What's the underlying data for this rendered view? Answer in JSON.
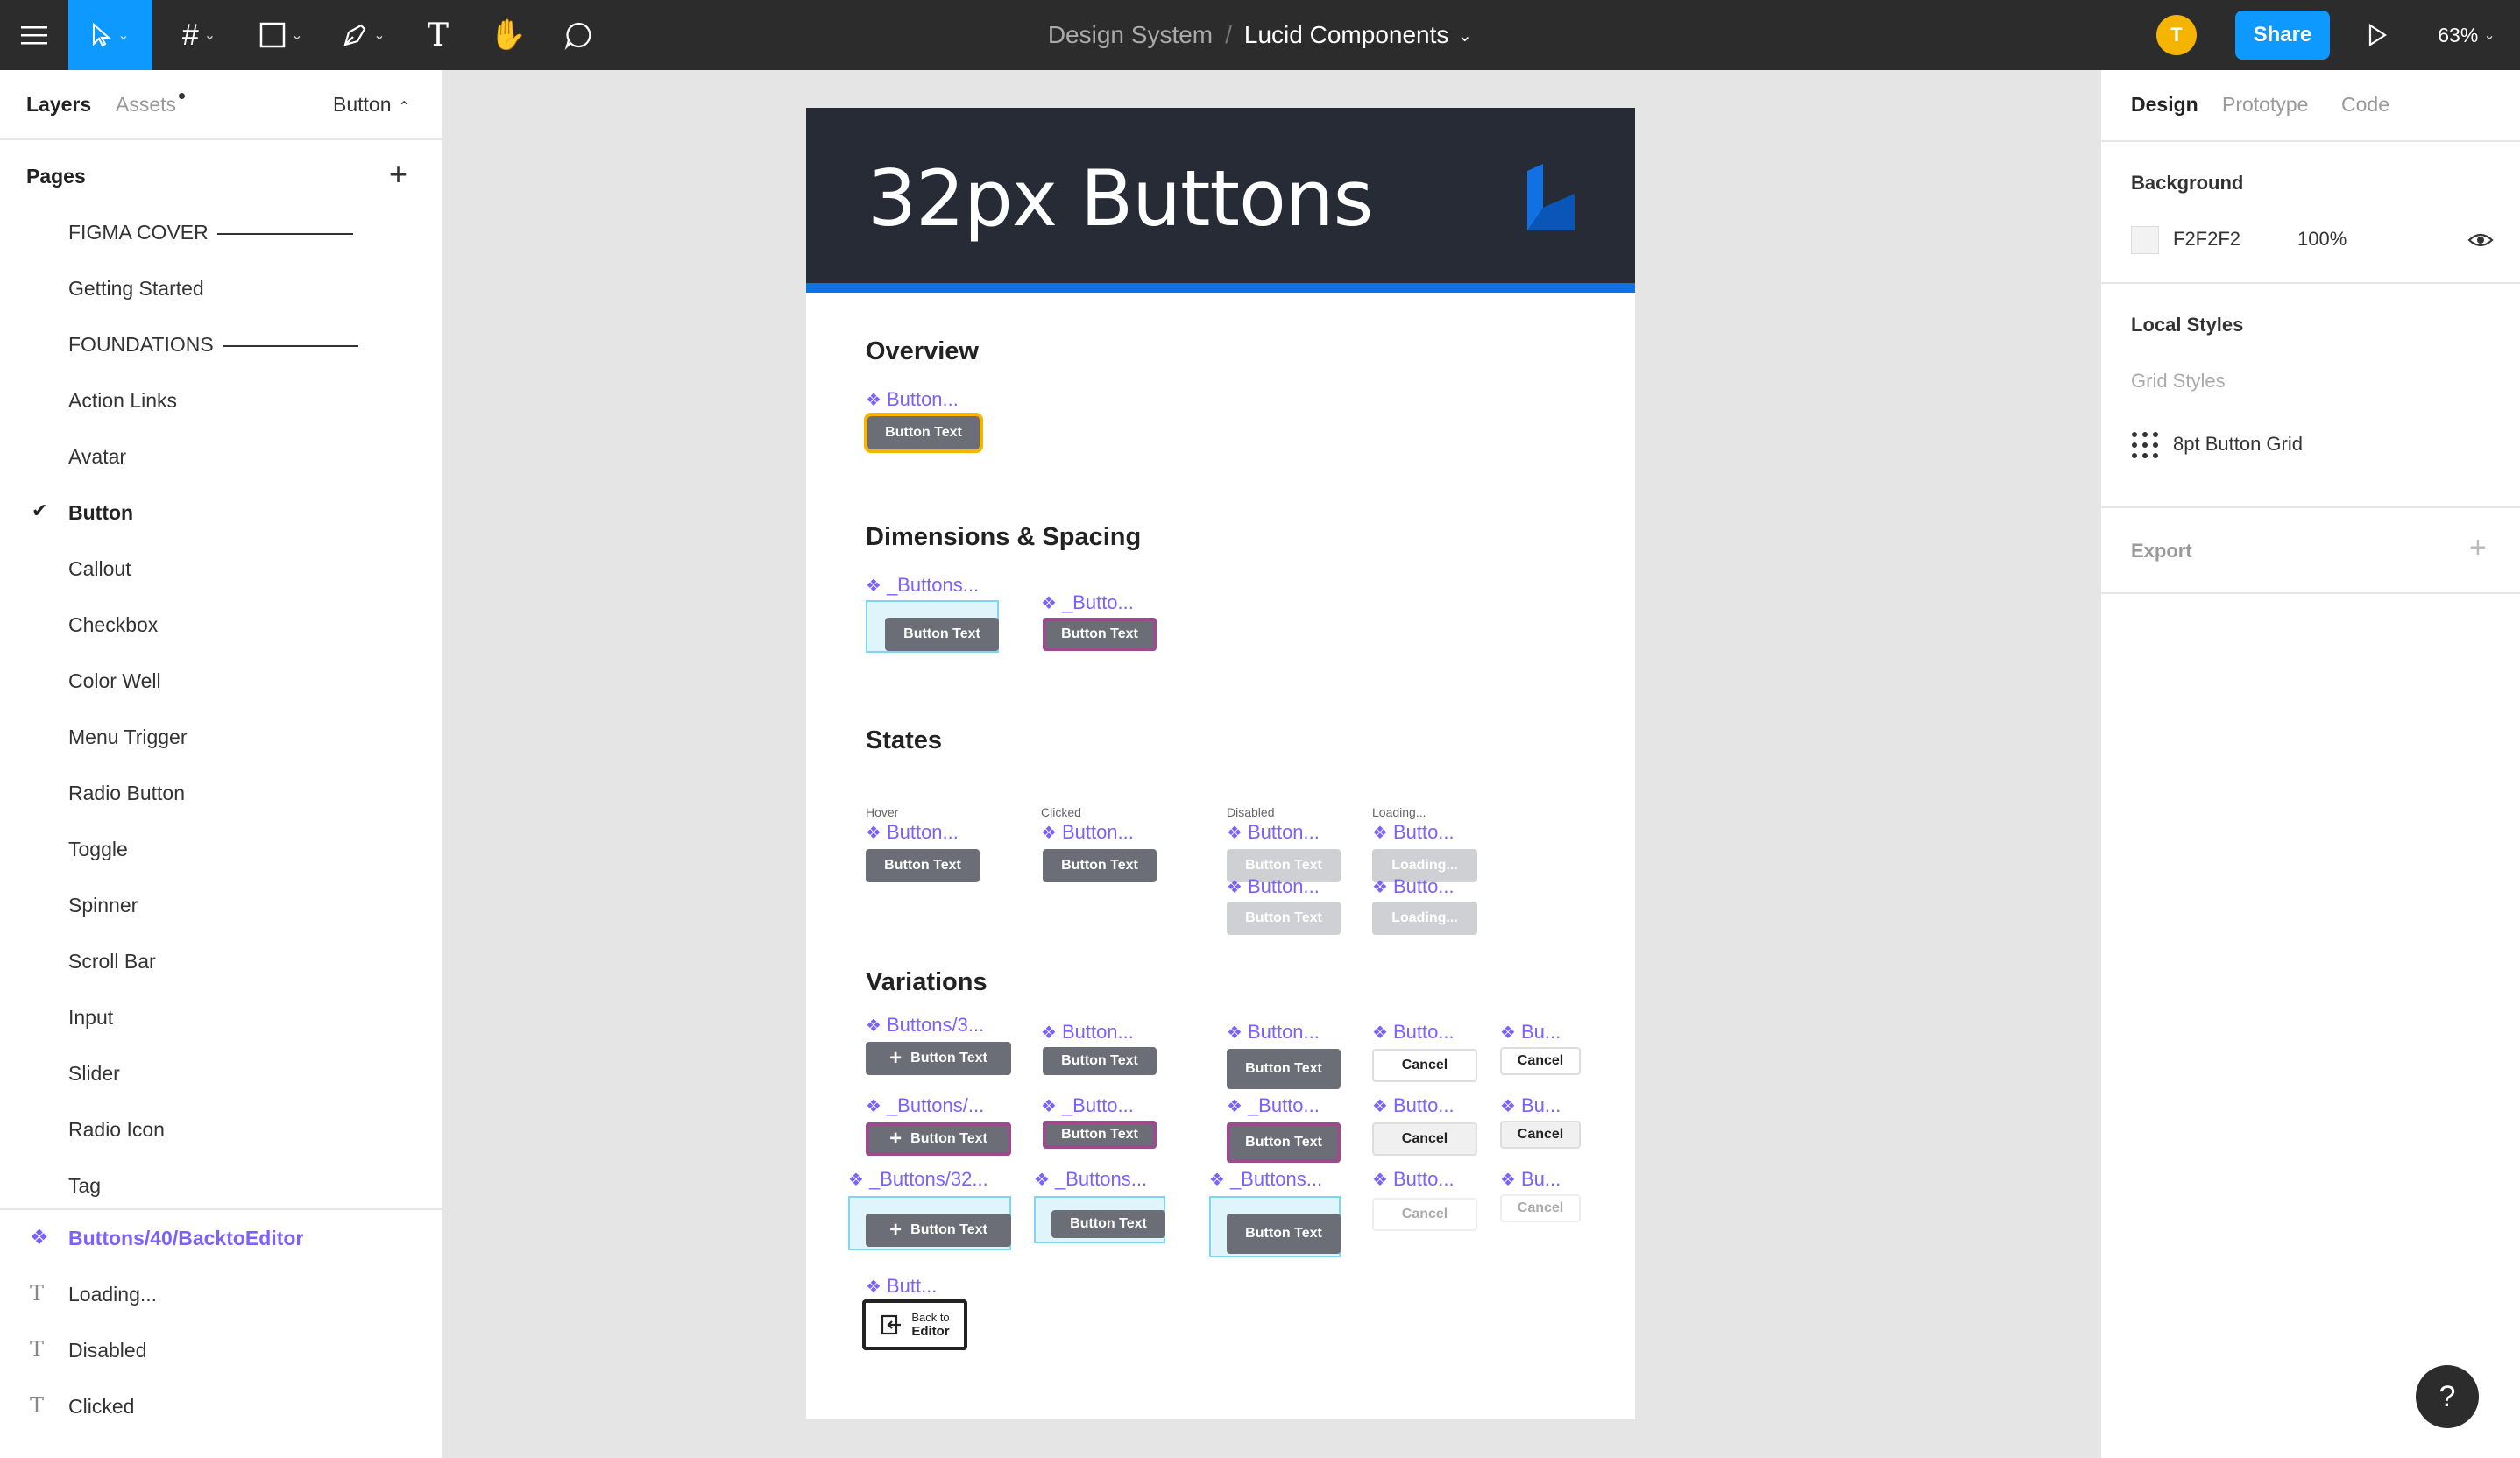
{
  "topbar": {
    "breadcrumb_team": "Design System",
    "breadcrumb_sep": "/",
    "file_name": "Lucid Components",
    "avatar_initial": "T",
    "share_label": "Share",
    "zoom": "63%"
  },
  "left_panel": {
    "tabs": {
      "layers": "Layers",
      "assets": "Assets",
      "current_page": "Button"
    },
    "pages_header": "Pages",
    "pages": [
      "FIGMA COVER",
      "Getting Started",
      "FOUNDATIONS",
      "Action Links",
      "Avatar",
      "Button",
      "Callout",
      "Checkbox",
      "Color Well",
      "Menu Trigger",
      "Radio Button",
      "Toggle",
      "Spinner",
      "Scroll Bar",
      "Input",
      "Slider",
      "Radio Icon",
      "Tag"
    ],
    "selected_page": "Button",
    "layers": [
      {
        "name": "Buttons/40/BacktoEditor",
        "type": "component"
      },
      {
        "name": "Loading...",
        "type": "text"
      },
      {
        "name": "Disabled",
        "type": "text"
      },
      {
        "name": "Clicked",
        "type": "text"
      }
    ]
  },
  "right_panel": {
    "tabs": {
      "design": "Design",
      "prototype": "Prototype",
      "code": "Code"
    },
    "background_label": "Background",
    "background_hex": "F2F2F2",
    "background_opacity": "100%",
    "local_styles_label": "Local Styles",
    "grid_styles_label": "Grid Styles",
    "grid_style_name": "8pt Button Grid",
    "export_label": "Export"
  },
  "canvas": {
    "frame_title": "32px Buttons",
    "sections": {
      "overview": "Overview",
      "dimensions": "Dimensions & Spacing",
      "states": "States",
      "variations": "Variations"
    },
    "button_text": "Button Text",
    "cancel_text": "Cancel",
    "loading_text": "Loading...",
    "back_to": "Back to",
    "editor": "Editor",
    "state_labels": {
      "hover": "Hover",
      "clicked": "Clicked",
      "disabled": "Disabled",
      "loading": "Loading..."
    },
    "component_names": {
      "overview": "Button...",
      "dim1": "_Buttons...",
      "dim2": "_Butto...",
      "hover": "Button...",
      "clicked": "Button...",
      "disabled1": "Button...",
      "disabled2": "Button...",
      "loading1": "Butto...",
      "loading2": "Butto...",
      "v_r1c1": "Buttons/3...",
      "v_r1c2": "Button...",
      "v_r1c3": "Button...",
      "v_r1c4": "Butto...",
      "v_r1c5": "Bu...",
      "v_r2c1": "_Buttons/...",
      "v_r2c2": "_Butto...",
      "v_r2c3": "_Butto...",
      "v_r2c4": "Butto...",
      "v_r2c5": "Bu...",
      "v_r3c1": "_Buttons/32...",
      "v_r3c2": "_Buttons...",
      "v_r3c3": "_Buttons...",
      "v_r3c4": "Butto...",
      "v_r3c5": "Bu...",
      "v_r4c1": "Butt..."
    }
  },
  "colors": {
    "brand": "#1071e5",
    "component": "#7b61ff",
    "share": "#0d99ff"
  }
}
